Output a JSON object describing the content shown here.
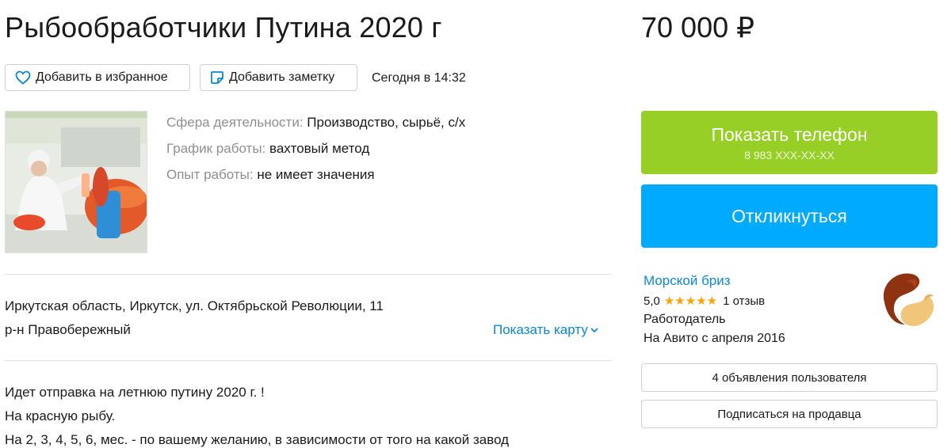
{
  "listing": {
    "title": "Рыбообработчики Путина 2020 г",
    "price": "70 000 ₽",
    "favorite_label": "Добавить в избранное",
    "note_label": "Добавить заметку",
    "date": "Сегодня в 14:32"
  },
  "params": [
    {
      "label": "Сфера деятельности:",
      "value": "Производство, сырьё, с/х"
    },
    {
      "label": "График работы:",
      "value": "вахтовый метод"
    },
    {
      "label": "Опыт работы:",
      "value": "не имеет значения"
    }
  ],
  "location": {
    "address": "Иркутская область, Иркутск, ул. Октябрьской Революции, 11",
    "district": "р-н Правобережный",
    "map_link": "Показать карту"
  },
  "description": {
    "lines": [
      "Идет отправка на летнюю путину 2020 г. !",
      "На красную рыбу.",
      "На 2, 3, 4, 5, 6, мес. - по вашему желанию, в зависимости от того на какой завод"
    ]
  },
  "actions": {
    "phone_label": "Показать телефон",
    "phone_number": "8 983 XXX-XX-XX",
    "reply_label": "Откликнуться"
  },
  "seller": {
    "name": "Морской бриз",
    "rating": "5,0",
    "reviews": "1 отзыв",
    "type": "Работодатель",
    "since": "На Авито с апреля 2016",
    "listings_button": "4 объявления пользователя",
    "subscribe_button": "Подписаться на продавца"
  },
  "icons": {
    "favorite": "heart-icon",
    "note": "note-icon",
    "map_chevron": "chevron-down-icon",
    "stars": "star-icon"
  },
  "colors": {
    "phone_button": "#97cf26",
    "reply_button": "#00aaff",
    "link": "#0a88d6",
    "stars": "#ffa200"
  }
}
